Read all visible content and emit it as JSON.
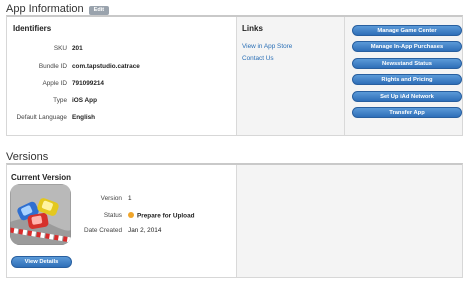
{
  "app_info": {
    "title": "App Information",
    "edit_label": "Edit",
    "identifiers": {
      "heading": "Identifiers",
      "rows": [
        {
          "label": "SKU",
          "value": "201"
        },
        {
          "label": "Bundle ID",
          "value": "com.tapstudio.catrace"
        },
        {
          "label": "Apple ID",
          "value": "791099214"
        },
        {
          "label": "Type",
          "value": "iOS App"
        },
        {
          "label": "Default Language",
          "value": "English"
        }
      ]
    },
    "links": {
      "heading": "Links",
      "items": [
        "View in App Store",
        "Contact Us"
      ]
    },
    "buttons": [
      "Manage Game Center",
      "Manage In-App Purchases",
      "Newsstand Status",
      "Rights and Pricing",
      "Set Up iAd Network",
      "Transfer App"
    ]
  },
  "versions": {
    "title": "Versions",
    "current": {
      "heading": "Current Version",
      "version_label": "Version",
      "version_value": "1",
      "status_label": "Status",
      "status_value": "Prepare for Upload",
      "date_label": "Date Created",
      "date_value": "Jan 2, 2014",
      "view_details_label": "View Details"
    }
  },
  "colors": {
    "button_blue": "#3a7cc4",
    "link_blue": "#2a6fb6",
    "status_orange": "#f0a52a"
  }
}
